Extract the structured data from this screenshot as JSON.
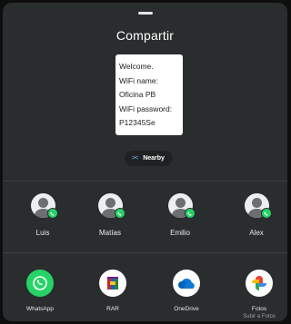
{
  "sheet": {
    "title": "Compartir"
  },
  "preview": {
    "lines": [
      "Welcome.",
      "WiFi name:",
      "Oficina PB",
      "WiFi password:",
      "P12345Se"
    ]
  },
  "nearby": {
    "icon": "nearby-share-icon",
    "label": "Nearby"
  },
  "contacts": [
    {
      "name": "Luis",
      "badge": "whatsapp-badge-icon"
    },
    {
      "name": "Matías",
      "badge": "whatsapp-badge-icon"
    },
    {
      "name": "Emilio",
      "badge": "whatsapp-badge-icon"
    },
    {
      "name": "Alex",
      "badge": "whatsapp-badge-icon"
    }
  ],
  "apps": [
    {
      "label": "WhatsApp",
      "sublabel": "",
      "icon": "whatsapp-icon"
    },
    {
      "label": "RAR",
      "sublabel": "",
      "icon": "rar-icon"
    },
    {
      "label": "OneDrive",
      "sublabel": "",
      "icon": "onedrive-icon"
    },
    {
      "label": "Fotos",
      "sublabel": "Subir a Fotos",
      "icon": "google-photos-icon"
    }
  ],
  "colors": {
    "sheet_background": "#2a2d2e",
    "whatsapp_green": "#25d366",
    "onedrive_blue": "#0f78d4",
    "nearby_accent": "#7db3ff"
  }
}
